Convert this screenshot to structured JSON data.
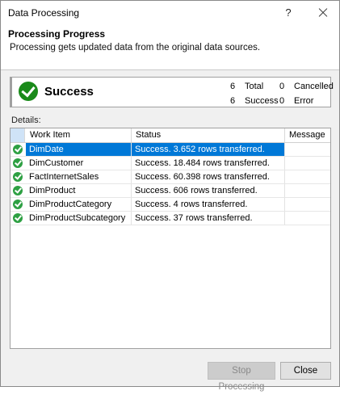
{
  "window": {
    "title": "Data Processing",
    "help_label": "?"
  },
  "header": {
    "title": "Processing Progress",
    "subtitle": "Processing gets updated data from the original data sources."
  },
  "status": {
    "label": "Success",
    "total_count": "6",
    "total_label": "Total",
    "cancelled_count": "0",
    "cancelled_label": "Cancelled",
    "success_count": "6",
    "success_label": "Success",
    "error_count": "0",
    "error_label": "Error"
  },
  "details_label": "Details:",
  "grid": {
    "columns": [
      "Work Item",
      "Status",
      "Message"
    ],
    "rows": [
      {
        "item": "DimDate",
        "status": "Success. 3.652 rows transferred.",
        "message": ""
      },
      {
        "item": "DimCustomer",
        "status": "Success. 18.484 rows transferred.",
        "message": ""
      },
      {
        "item": "FactInternetSales",
        "status": "Success. 60.398 rows transferred.",
        "message": ""
      },
      {
        "item": "DimProduct",
        "status": "Success. 606 rows transferred.",
        "message": ""
      },
      {
        "item": "DimProductCategory",
        "status": "Success. 4 rows transferred.",
        "message": ""
      },
      {
        "item": "DimProductSubcategory",
        "status": "Success. 37 rows transferred.",
        "message": ""
      }
    ]
  },
  "buttons": {
    "stop_label": "Stop Processing",
    "close_label": "Close"
  },
  "colors": {
    "accent": "#0078d7",
    "success": "#1a8a1a"
  }
}
